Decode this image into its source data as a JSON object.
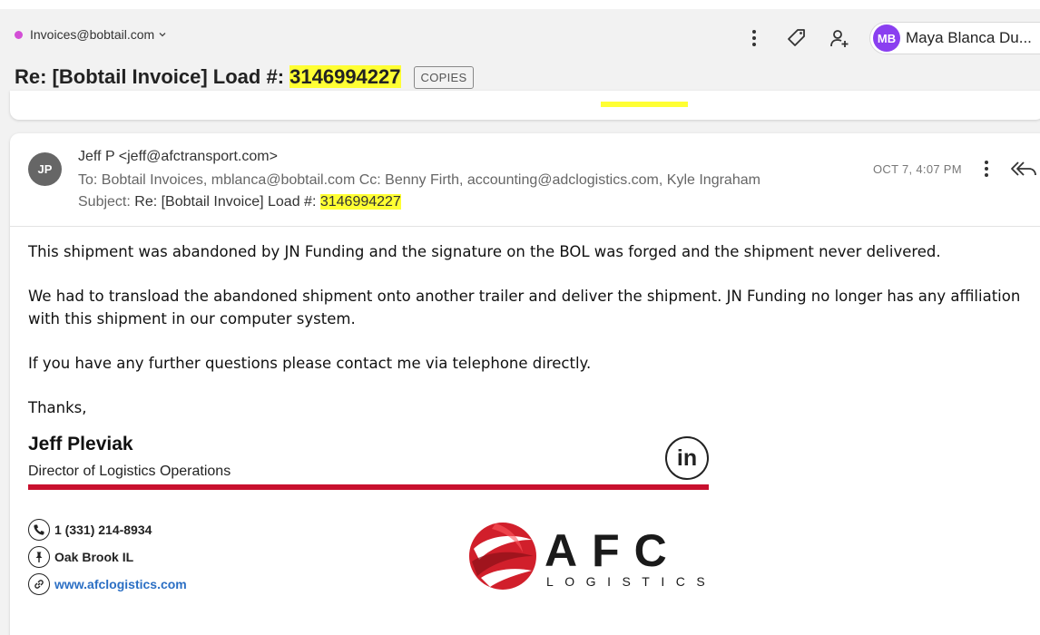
{
  "header": {
    "account": "Invoices@bobtail.com",
    "user_initials": "MB",
    "user_name": "Maya Blanca Du...",
    "subject_prefix": "Re: [Bobtail Invoice] Load #: ",
    "subject_load": "3146994227",
    "copies_label": "COPIES"
  },
  "message": {
    "sender_initials": "JP",
    "from": "Jeff P <jeff@afctransport.com>",
    "to": "To: Bobtail Invoices, mblanca@bobtail.com Cc: Benny Firth, accounting@adclogistics.com, Kyle Ingraham",
    "subject_label": "Subject: ",
    "subject_value": "Re: [Bobtail Invoice] Load #: ",
    "subject_load": "3146994227",
    "date": "OCT 7, 4:07 PM",
    "body": {
      "p1": "This shipment was abandoned by JN Funding and the signature on the BOL was forged and the shipment never delivered.",
      "p2": "We had to transload the abandoned shipment onto another trailer and deliver the shipment.  JN Funding no longer has any affiliation with this shipment in our computer system.",
      "p3": "If you have any further questions please contact me via telephone directly.",
      "p4": "Thanks,"
    }
  },
  "signature": {
    "name": "Jeff Pleviak",
    "title": "Director of Logistics Operations",
    "linkedin": "in",
    "phone": "1 (331) 214-8934",
    "location": "Oak Brook IL",
    "website": "www.afclogistics.com",
    "logo_main": "AFC",
    "logo_sub": "LOGISTICS"
  },
  "colors": {
    "highlight": "#ffff33",
    "avatar_mb": "#8a3ff0",
    "account_dot": "#d34fd6",
    "sig_red": "#c8102e",
    "link": "#2b6fc4"
  },
  "icons": [
    "more-vert-icon",
    "tag-icon",
    "add-person-icon",
    "chevron-down-icon",
    "reply-all-icon",
    "phone-icon",
    "pin-icon",
    "link-icon",
    "linkedin-icon"
  ]
}
